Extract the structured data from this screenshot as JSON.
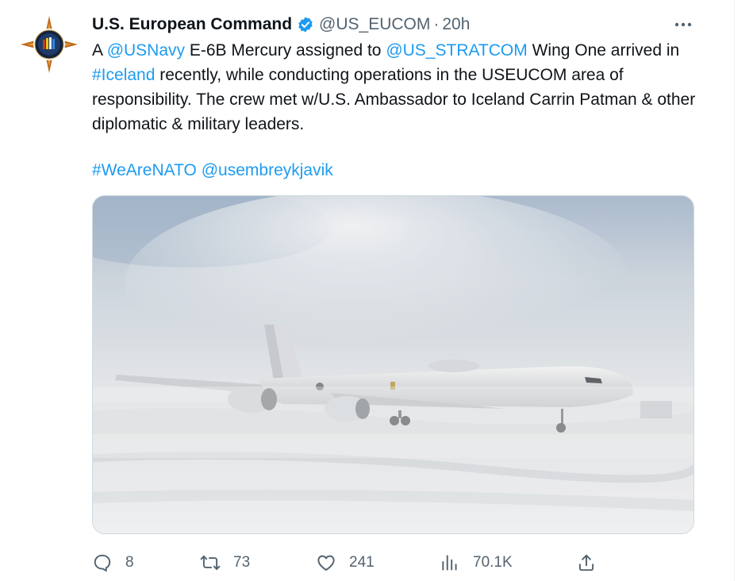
{
  "tweet": {
    "author_name": "U.S. European Command",
    "handle": "@US_EUCOM",
    "separator": "·",
    "time": "20h",
    "verified_icon": "verified-badge-icon",
    "more_icon": "more-icon",
    "text": {
      "p1": "A ",
      "mention_usnavy": "@USNavy",
      "p2": " E-6B Mercury assigned to ",
      "mention_stratcom": "@US_STRATCOM",
      "p3": " Wing One arrived in ",
      "hashtag_iceland": "#Iceland",
      "p4": " recently, while conducting operations in the USEUCOM area of responsibility. The crew met w/U.S. Ambassador to Iceland Carrin Patman & other diplomatic & military leaders."
    },
    "tags": {
      "hashtag_wearenato": "#WeAreNATO",
      "mention_embassy": "@usembreykjavik"
    },
    "media": {
      "description_icon": "photo-e6b-aircraft-snow"
    },
    "actions": {
      "replies": "8",
      "retweets": "73",
      "likes": "241",
      "views": "70.1K"
    },
    "colors": {
      "link": "#1d9bf0",
      "text": "#0f1419",
      "secondary": "#536471"
    }
  }
}
